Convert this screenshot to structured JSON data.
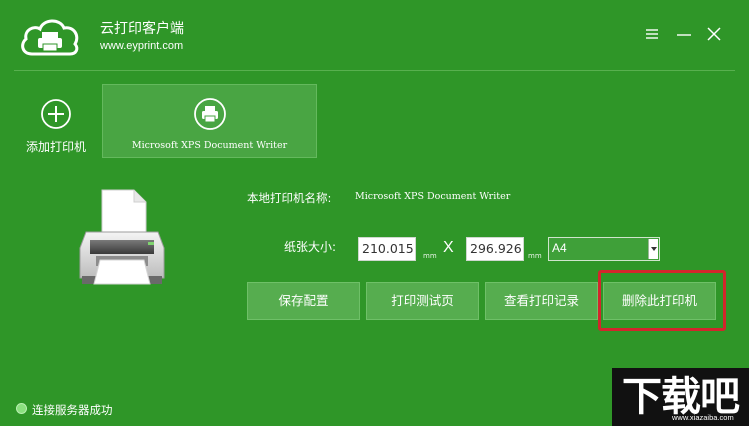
{
  "header": {
    "title": "云打印客户端",
    "url": "www.eyprint.com"
  },
  "sidebar": {
    "add_printer_label": "添加打印机",
    "printers": [
      {
        "label": "Microsoft XPS Document Writer"
      }
    ]
  },
  "details": {
    "name_label": "本地打印机名称:",
    "name_value": "Microsoft XPS Document Writer",
    "size_label": "纸张大小:",
    "width_value": "210.015",
    "height_value": "296.926",
    "unit": "mm",
    "times_symbol": "X",
    "paper_selected": "A4"
  },
  "actions": {
    "save": "保存配置",
    "test": "打印测试页",
    "log": "查看打印记录",
    "delete": "删除此打印机"
  },
  "status": {
    "text": "连接服务器成功"
  },
  "watermark": {
    "text": "下载吧",
    "sub": "www.xiazaiba.com"
  },
  "colors": {
    "background": "#2f9628",
    "highlight": "#d2262c"
  },
  "icons": {
    "logo": "cloud-printer-icon",
    "menu": "menu-icon",
    "minimize": "minimize-icon",
    "close": "close-icon",
    "add": "plus-circle-icon",
    "printer": "printer-icon"
  }
}
